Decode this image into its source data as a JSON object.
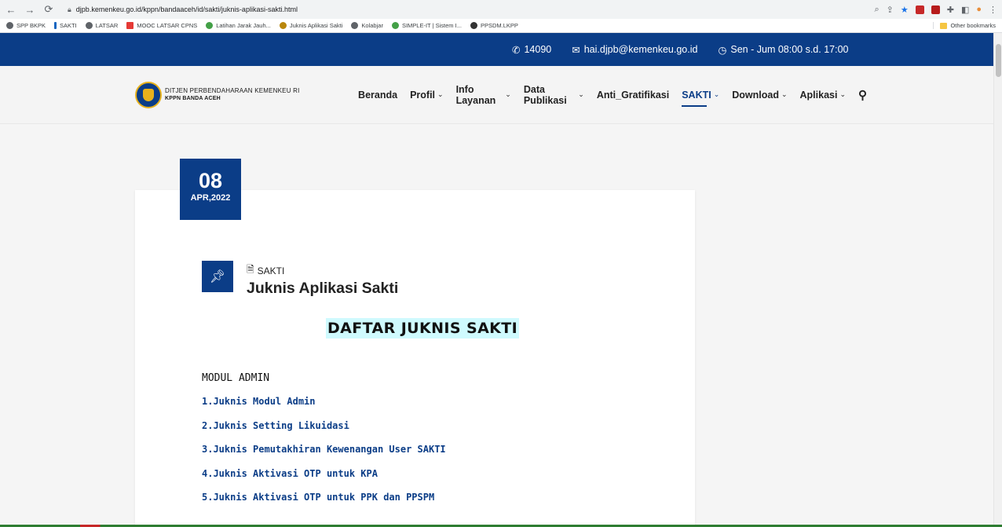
{
  "browser": {
    "url": "djpb.kemenkeu.go.id/kppn/bandaaceh/id/sakti/juknis-aplikasi-sakti.html",
    "bookmarks": [
      "SPP BKPK",
      "SAKTI",
      "LATSAR",
      "MOOC LATSAR CPNS",
      "Latihan Jarak Jauh...",
      "Juknis Aplikasi Sakti",
      "Kolabjar",
      "SIMPLE-IT | Sistem I...",
      "PPSDM.LKPP"
    ],
    "other_bookmarks": "Other bookmarks"
  },
  "topbar": {
    "phone": "14090",
    "email": "hai.djpb@kemenkeu.go.id",
    "hours": "Sen - Jum 08:00 s.d. 17:00"
  },
  "logo": {
    "line1": "DITJEN PERBENDAHARAAN KEMENKEU RI",
    "line2": "KPPN BANDA ACEH"
  },
  "menu": [
    {
      "label": "Beranda",
      "dropdown": false
    },
    {
      "label": "Profil",
      "dropdown": true
    },
    {
      "label": "Info Layanan",
      "dropdown": true
    },
    {
      "label": "Data Publikasi",
      "dropdown": true
    },
    {
      "label": "Anti_Gratifikasi",
      "dropdown": false
    },
    {
      "label": "SAKTI",
      "dropdown": true,
      "active": true
    },
    {
      "label": "Download",
      "dropdown": true
    },
    {
      "label": "Aplikasi",
      "dropdown": true
    }
  ],
  "post": {
    "date_day": "08",
    "date_month_year": "APR,2022",
    "category": "SAKTI",
    "title": "Juknis Aplikasi Sakti",
    "heading": "DAFTAR JUKNIS SAKTI",
    "section": "MODUL ADMIN",
    "links": [
      "1.Juknis Modul Admin",
      "2.Juknis Setting Likuidasi",
      "3.Juknis Pemutakhiran Kewenangan User SAKTI",
      "4.Juknis Aktivasi OTP untuk KPA",
      "5.Juknis Aktivasi OTP untuk PPK dan PPSPM"
    ]
  },
  "colors": {
    "brand": "#0b3d87",
    "highlight": "#cffafe"
  }
}
